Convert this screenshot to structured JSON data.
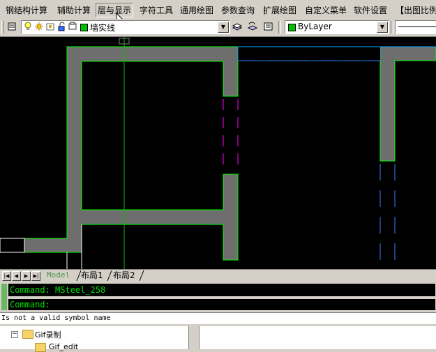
{
  "menubar": {
    "items": [
      {
        "label": "钢结构计算"
      },
      {
        "label": "辅助计算"
      },
      {
        "label": "层与显示"
      },
      {
        "label": "字符工具"
      },
      {
        "label": "通用绘图"
      },
      {
        "label": "参数查询"
      },
      {
        "label": "扩展绘图"
      },
      {
        "label": "自定义菜单"
      },
      {
        "label": "软件设置"
      },
      {
        "label": "【出图比例"
      }
    ]
  },
  "toolbar": {
    "layer_combo": {
      "value": "墙实线",
      "swatch_color": "#00c000"
    },
    "color_combo": {
      "value": "ByLayer",
      "swatch_color": "#00c000"
    }
  },
  "layout_tabs": {
    "tabs": [
      {
        "label": "Model"
      },
      {
        "label": "布局1"
      },
      {
        "label": "布局2"
      }
    ]
  },
  "command": {
    "history": "Command: MSteel_258",
    "prompt": "Command:"
  },
  "status": {
    "message": "Is not a valid symbol name"
  },
  "explorer": {
    "items": [
      {
        "label": "Gif录制",
        "expander": "−"
      },
      {
        "label": "Gif_edit"
      }
    ]
  },
  "colors": {
    "wall_fill": "#6e6e6e",
    "wall_outline": "#00ff00",
    "dashed_magenta": "#ff00ff",
    "dashed_blue": "#3a7bff",
    "command_text": "#00e000"
  }
}
